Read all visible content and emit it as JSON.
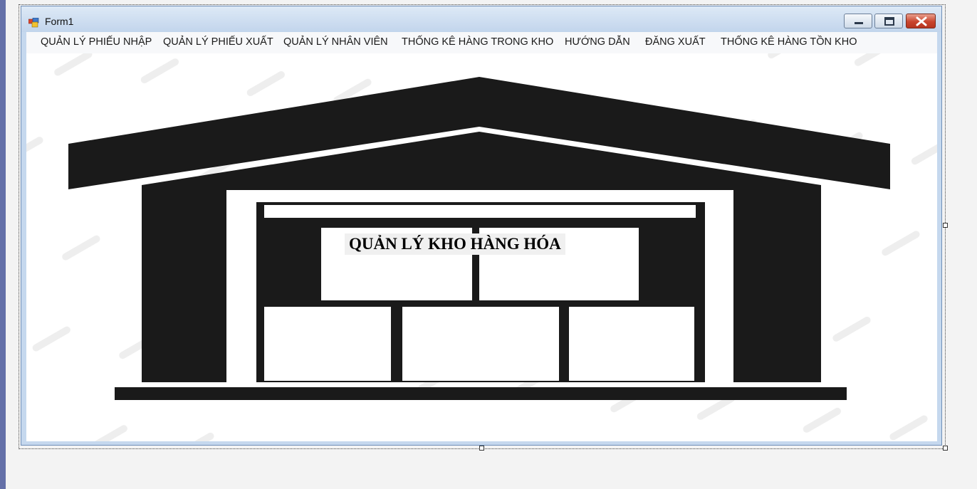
{
  "window": {
    "title": "Form1"
  },
  "menu": {
    "items": [
      "QUẢN LÝ PHIẾU NHẬP",
      "QUẢN LÝ PHIẾU XUẤT",
      "QUẢN LÝ NHÂN VIÊN",
      "THỐNG KÊ HÀNG TRONG KHO",
      "HƯỚNG DẪN",
      "ĐĂNG XUẤT",
      "THỐNG KÊ HÀNG TỒN KHO"
    ]
  },
  "main": {
    "heading": "QUẢN LÝ KHO HÀNG HÓA"
  },
  "icons": {
    "app": "form-app-icon",
    "minimize": "minimize-icon",
    "maximize": "maximize-icon",
    "close": "close-icon",
    "illustration": "warehouse-icon"
  },
  "colors": {
    "titlebar": "#c2d5ec",
    "close_button": "#c9452e",
    "illustration": "#1a1a1a"
  }
}
